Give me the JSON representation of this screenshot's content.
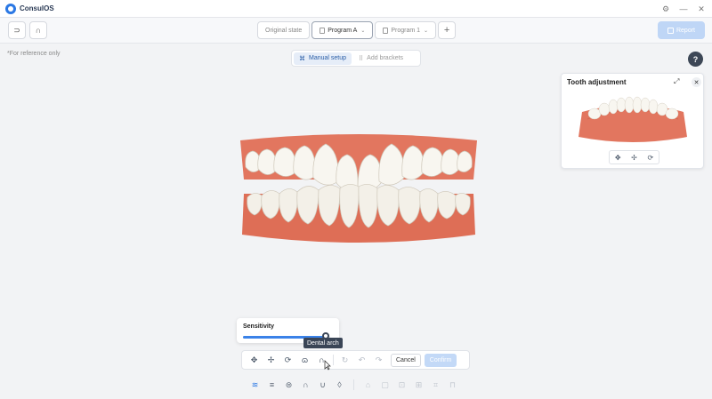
{
  "app": {
    "name": "ConsulOS"
  },
  "window_controls": {
    "settings": "⚙",
    "minimize": "—",
    "close": "✕"
  },
  "toolbar": {
    "left_buttons": [
      "⊃",
      "∩"
    ],
    "tabs": [
      {
        "label": "Original state",
        "active": false,
        "has_doc_icon": false,
        "has_chevron": false
      },
      {
        "label": "Program A",
        "active": true,
        "has_doc_icon": true,
        "has_chevron": true
      },
      {
        "label": "Program 1",
        "active": false,
        "has_doc_icon": true,
        "has_chevron": true
      }
    ],
    "add_tab": "+",
    "report_label": "Report"
  },
  "reference_note": "*For reference only",
  "mode_toggle": {
    "manual": "Manual setup",
    "brackets": "Add brackets"
  },
  "help": "?",
  "tooth_panel": {
    "title": "Tooth adjustment",
    "expand": "⤢",
    "close": "✕",
    "tools": [
      "✥",
      "✢",
      "⟳"
    ]
  },
  "sensitivity": {
    "label": "Sensitivity",
    "level": 0.95
  },
  "tooltip": "Dental arch",
  "action_bar": {
    "tools": [
      "✥",
      "✢",
      "⟳",
      "ɷ",
      "∩"
    ],
    "history": [
      "↻",
      "↶",
      "↷"
    ],
    "cancel": "Cancel",
    "confirm": "Confirm"
  },
  "view_bar": {
    "views": [
      "≋",
      "≡",
      "⊜",
      "∩",
      "∪",
      "◊"
    ],
    "extras": [
      "⌂",
      "▢",
      "⊡",
      "⊞",
      "⌗",
      "⊓"
    ]
  },
  "colors": {
    "accent": "#2b78e4",
    "gum": "#e2765f",
    "tooth": "#f7f5ef",
    "dark": "#3a4556"
  }
}
